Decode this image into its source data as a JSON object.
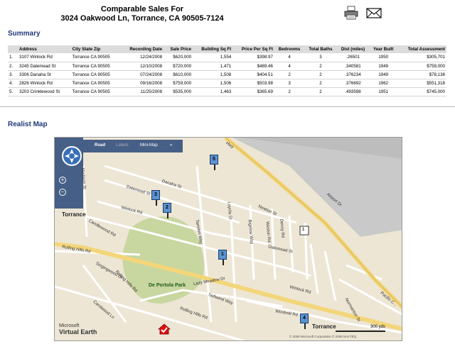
{
  "header": {
    "title_line1": "Comparable Sales For",
    "title_line2": "3024 Oakwood Ln, Torrance, CA 90505-7124"
  },
  "icons": {
    "print": "printer-icon",
    "email": "envelope-icon"
  },
  "summary": {
    "heading": "Summary",
    "columns": [
      "Address",
      "City State Zip",
      "Recording Date",
      "Sale Price",
      "Building Sq Ft",
      "Price Per Sq Ft",
      "Bedrooms",
      "Total Baths",
      "Dist (miles)",
      "Year Built",
      "Total Assessment"
    ],
    "rows": [
      [
        "1.",
        "3107 Winlock Rd",
        "Torrance CA 90505",
        "12/24/2008",
        "$620,000",
        "1,554",
        "$398.97",
        "4",
        "3",
        ".26501",
        "1950",
        "$305,701"
      ],
      [
        "2.",
        "3245 Dalemead St",
        "Torrance CA 90505",
        "12/10/2008",
        "$720,000",
        "1,471",
        "$489.46",
        "4",
        "2",
        ".340581",
        "1949",
        "$759,000"
      ],
      [
        "3.",
        "3306 Danaha St",
        "Torrance CA 90505",
        "07/24/2008",
        "$610,000",
        "1,508",
        "$404.51",
        "2",
        "2",
        ".376234",
        "1949",
        "$78,138"
      ],
      [
        "4.",
        "2826 Winlock Rd",
        "Torrance CA 90505",
        "09/16/2008",
        "$759,000",
        "1,506",
        "$503.98",
        "3",
        "2",
        ".376692",
        "1962",
        "$551,318"
      ],
      [
        "5.",
        "3203 Crinklewood St",
        "Torrance CA 90505",
        "11/25/2008",
        "$535,000",
        "1,463",
        "$365.69",
        "2",
        "2",
        ".493598",
        "1951",
        "$745,000"
      ]
    ]
  },
  "map_section": {
    "heading": "Realist Map",
    "toolbar": {
      "road": "Road",
      "labels": "Labels",
      "minimap": "Mini-Map",
      "collapse": "«"
    },
    "zoom_in": "+",
    "zoom_out": "−",
    "labels": {
      "torrance_top": "Torrance",
      "torrance_bottom": "Torrance",
      "danaha": "Danaha St",
      "dalemead": "Dalemead St",
      "dalemead2": "Dalemead St",
      "winlock": "Winlock Rd",
      "winlock2": "Winlock Rd",
      "newton": "Newton St",
      "candlewood": "Candlewood Rd",
      "rolling_hills": "Rolling Hills Rd",
      "rolling_hills2": "Rolling Hills Rd",
      "rolling_hills_way": "Rolling Hills Rd",
      "de_portola": "De Portola Park",
      "tamden": "Tamden Way",
      "lazy_meadow": "Lazy Meadow Dr",
      "softwind": "Softwind Way",
      "windmill": "Windmill Rd",
      "airport": "Airport Dr",
      "pacific": "Pacific C...",
      "madison": "Madison St",
      "carolwood": "Carolwood Ln",
      "singingwood": "Singingwood Dr",
      "bigelow": "Bigelow Way",
      "loyola": "Loyola St",
      "weston": "Weston Rd",
      "denny": "Denny Rd",
      "normanton": "Normanton St",
      "hwy": "Hwy",
      "route1": "1"
    },
    "markers": [
      "1",
      "2",
      "3",
      "4",
      "5"
    ],
    "logo_line1": "Microsoft",
    "logo_line2": "Virtual Earth",
    "scale": "300 yds",
    "copyright": "© 2008 Microsoft Corporation   © 2008 NAVTEQ"
  },
  "colors": {
    "heading": "#1f3a78",
    "map_bg": "#ede6d5",
    "road_major": "#f3d67a",
    "park": "#c8d6a0",
    "marker": "#5b93d0"
  }
}
